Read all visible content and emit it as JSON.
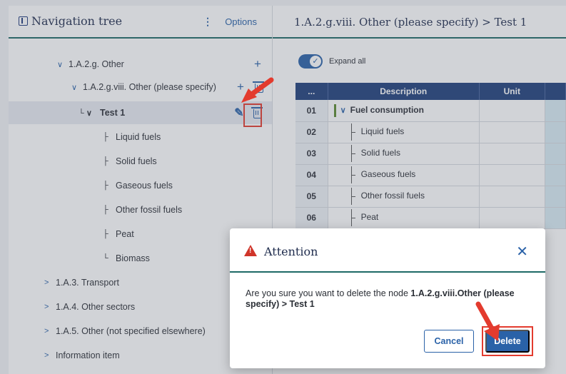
{
  "nav": {
    "title": "Navigation tree",
    "options_label": "Options",
    "items": [
      {
        "label": "1.A.2.g. Other",
        "prefix": "∨"
      },
      {
        "label": "1.A.2.g.viii. Other (please specify)",
        "prefix": "∨"
      },
      {
        "label": "Test 1",
        "prefix": "└ ∨"
      },
      {
        "label": "Liquid fuels",
        "prefix": "├"
      },
      {
        "label": "Solid fuels",
        "prefix": "├"
      },
      {
        "label": "Gaseous fuels",
        "prefix": "├"
      },
      {
        "label": "Other fossil fuels",
        "prefix": "├"
      },
      {
        "label": "Peat",
        "prefix": "├"
      },
      {
        "label": "Biomass",
        "prefix": "└"
      },
      {
        "label": "1.A.3. Transport",
        "prefix": ">"
      },
      {
        "label": "1.A.4. Other sectors",
        "prefix": ">"
      },
      {
        "label": "1.A.5. Other (not specified elsewhere)",
        "prefix": ">"
      },
      {
        "label": "Information item",
        "prefix": ">"
      }
    ]
  },
  "main": {
    "title": "1.A.2.g.viii. Other (please specify) > Test 1",
    "expand_all": "Expand all",
    "table": {
      "headers": [
        "...",
        "Description",
        "Unit"
      ],
      "rows": [
        {
          "num": "01",
          "desc": "Fuel consumption"
        },
        {
          "num": "02",
          "desc": "Liquid fuels"
        },
        {
          "num": "03",
          "desc": "Solid fuels"
        },
        {
          "num": "04",
          "desc": "Gaseous fuels"
        },
        {
          "num": "05",
          "desc": "Other fossil fuels"
        },
        {
          "num": "06",
          "desc": "Peat"
        }
      ]
    }
  },
  "modal": {
    "title": "Attention",
    "message_prefix": "Are you sure you want to delete the node ",
    "message_node": "1.A.2.g.viii.Other (please specify) > Test 1",
    "cancel_label": "Cancel",
    "delete_label": "Delete"
  },
  "colors": {
    "accent": "#2a62a8",
    "header_bar": "#1f3f7a",
    "divider": "#1e6a66",
    "callout": "#e33b2e"
  }
}
